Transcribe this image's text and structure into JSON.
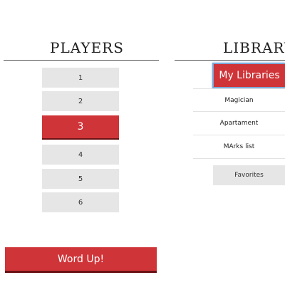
{
  "players": {
    "title": "PLAYERS",
    "options": [
      "1",
      "2",
      "3",
      "4",
      "5",
      "6"
    ],
    "selected": "3",
    "submit_label": "Word Up!"
  },
  "library": {
    "title": "LIBRARY",
    "my_libraries_label": "My Libraries",
    "items": [
      "Magician",
      "Apartament",
      "MArks list"
    ],
    "favorites_label": "Favorites"
  },
  "colors": {
    "accent": "#cf3438",
    "button_gray": "#e6e6e6"
  }
}
